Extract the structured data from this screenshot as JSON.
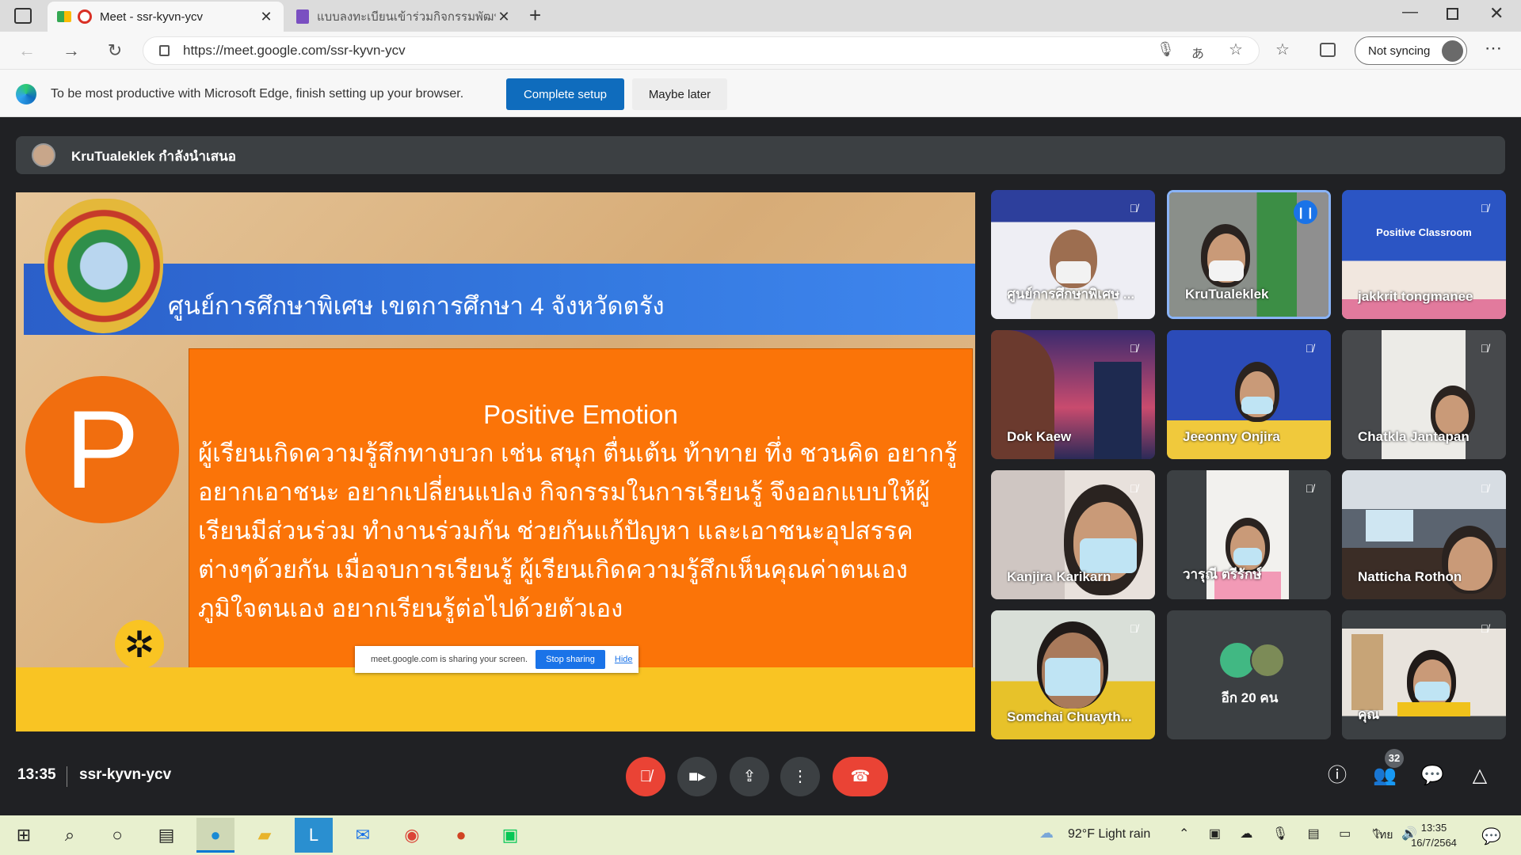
{
  "browser": {
    "tabs": [
      {
        "title": "Meet - ssr-kyvn-ycv"
      },
      {
        "title": "แบบลงทะเบียนเข้าร่วมกิจกรรมพัฒนา..."
      }
    ],
    "url": "https://meet.google.com/ssr-kyvn-ycv",
    "sync_label": "Not syncing",
    "infobar": {
      "message": "To be most productive with Microsoft Edge, finish setting up your browser.",
      "complete_label": "Complete setup",
      "later_label": "Maybe later"
    }
  },
  "meet": {
    "presenter_banner": "KruTualeklek กำลังนำเสนอ",
    "slide": {
      "title": "ศูนย์การศึกษาพิเศษ เขตการศึกษา 4 จังหวัดตรัง",
      "heading": "Positive Emotion",
      "letter": "P",
      "body": "ผู้เรียนเกิดความรู้สึกทางบวก เช่น สนุก ตื่นเต้น ท้าทาย ทึ่ง ชวนคิด อยากรู้ อยากเอาชนะ อยากเปลี่ยนแปลง กิจกรรมในการเรียนรู้ จึงออกแบบให้ผู้เรียนมีส่วนร่วม  ทำงานร่วมกัน ช่วยกันแก้ปัญหา และเอาชนะอุปสรรคต่างๆด้วยกัน เมื่อจบการเรียนรู้ ผู้เรียนเกิดความรู้สึกเห็นคุณค่าตนเอง ภูมิใจตนเอง อยากเรียนรู้ต่อไปด้วยตัวเอง"
    },
    "share_bar": {
      "text": "meet.google.com is sharing your screen.",
      "stop_label": "Stop sharing",
      "hide_label": "Hide"
    },
    "participants": [
      {
        "name": "ศูนย์การศึกษาพิเศษ ..."
      },
      {
        "name": "KruTualeklek"
      },
      {
        "name": "jakkrit tongmanee"
      },
      {
        "name": "Dok Kaew"
      },
      {
        "name": "Jeeonny Onjira"
      },
      {
        "name": "Chatkla Jantapan"
      },
      {
        "name": "Kanjira Karikarn"
      },
      {
        "name": "วารุณี ตรีรักษ์"
      },
      {
        "name": "Natticha Rothon"
      },
      {
        "name": "Somchai Chuayth..."
      },
      {
        "name": "อีก 20 คน"
      },
      {
        "name": "คุณ"
      }
    ],
    "time": "13:35",
    "meeting_code": "ssr-kyvn-ycv",
    "participant_count": "32"
  },
  "taskbar": {
    "weather": "92°F  Light rain",
    "language": "ไทย",
    "time": "13:35",
    "date": "16/7/2564"
  }
}
